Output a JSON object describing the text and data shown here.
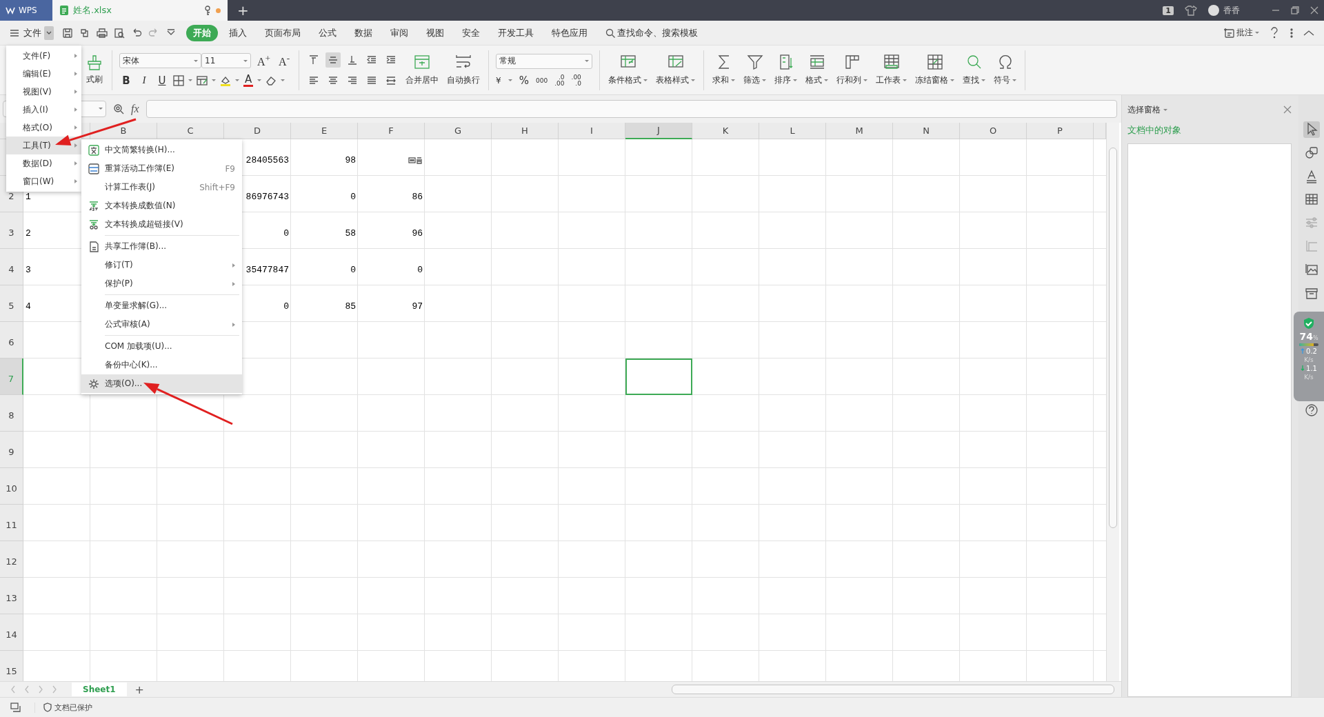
{
  "title_bar": {
    "app_tab": "WPS",
    "document_tab": {
      "title": "姓名.xlsx",
      "selected": true,
      "unsaved": true
    },
    "new_tab": "+",
    "page_count": "1",
    "user_name": "香香"
  },
  "menu_bar": {
    "file_menu": "文件",
    "tabs": [
      {
        "label": "开始",
        "selected": true
      },
      {
        "label": "插入",
        "selected": false
      },
      {
        "label": "页面布局",
        "selected": false
      },
      {
        "label": "公式",
        "selected": false
      },
      {
        "label": "数据",
        "selected": false
      },
      {
        "label": "审阅",
        "selected": false
      },
      {
        "label": "视图",
        "selected": false
      },
      {
        "label": "安全",
        "selected": false
      },
      {
        "label": "开发工具",
        "selected": false
      },
      {
        "label": "特色应用",
        "selected": false
      }
    ],
    "search": {
      "placeholder": "查找命令、搜索模板"
    },
    "comment_button": "批注"
  },
  "ribbon": {
    "format_painter": "式刷",
    "font_name": "宋体",
    "font_size": "11",
    "font_size_buttons": [
      "A$^{+}$",
      "A$^{-}$"
    ],
    "style_buttons": [
      "B",
      "I",
      "U"
    ],
    "font_color": "A",
    "align_buttons": [
      {
        "selected": false
      },
      {
        "selected": true
      },
      {
        "selected": false
      },
      {
        "selected": false
      },
      {
        "selected": false
      },
      {
        "selected": false
      },
      {
        "selected": false
      },
      {
        "selected": false
      },
      {
        "selected": false
      },
      {
        "selected": false
      }
    ],
    "merge_button": "合并居中",
    "wrap_button": "自动换行",
    "number_format": "常规",
    "number_buttons": [
      {
        "kind": "currency",
        "label": "¥"
      },
      {
        "kind": "percent",
        "label": "%"
      },
      {
        "kind": "thousands",
        "label": "000"
      },
      {
        "kind": "increase_decimal",
        "top": ".0",
        "bottom": ".00"
      },
      {
        "kind": "decrease_decimal",
        "top": ".00",
        "bottom": ".0"
      }
    ],
    "tools": [
      "条件格式",
      "表格样式",
      "求和",
      "筛选",
      "排序",
      "格式",
      "行和列",
      "工作表",
      "冻结窗格",
      "查找",
      "符号"
    ]
  },
  "formula_bar": {
    "fx": "fx"
  },
  "sheet": {
    "columns": [
      {
        "selected": false
      },
      {
        "label": "B",
        "selected": false
      },
      {
        "label": "C",
        "selected": false
      },
      {
        "label": "D",
        "selected": false
      },
      {
        "label": "E",
        "selected": false
      },
      {
        "label": "F",
        "selected": false
      },
      {
        "label": "G",
        "selected": false
      },
      {
        "label": "H",
        "selected": false
      },
      {
        "label": "I",
        "selected": false
      },
      {
        "label": "J",
        "selected": true
      },
      {
        "label": "K",
        "selected": false
      },
      {
        "label": "L",
        "selected": false
      },
      {
        "label": "M",
        "selected": false
      },
      {
        "label": "N",
        "selected": false
      },
      {
        "label": "O",
        "selected": false
      },
      {
        "label": "P",
        "selected": false
      }
    ],
    "rows": [
      {
        "selected": false,
        "cells": [
          null,
          null,
          null,
          "28405563",
          "98",
          {
            "kind": "glyph"
          }
        ]
      },
      {
        "header": "2",
        "selected": false,
        "cells": [
          "1",
          null,
          null,
          "86976743",
          "0",
          "86"
        ]
      },
      {
        "header": "3",
        "selected": false,
        "cells": [
          "2",
          null,
          null,
          "0",
          "58",
          "96"
        ]
      },
      {
        "header": "4",
        "selected": false,
        "cells": [
          "3",
          null,
          null,
          "35477847",
          "0",
          "0"
        ]
      },
      {
        "header": "5",
        "selected": false,
        "cells": [
          "4",
          null,
          null,
          "0",
          "85",
          "97"
        ]
      },
      {
        "header": "6",
        "selected": false,
        "cells": []
      },
      {
        "header": "7",
        "selected": true,
        "cells": []
      },
      {
        "header": "8",
        "selected": false,
        "cells": []
      },
      {
        "header": "9",
        "selected": false,
        "cells": []
      },
      {
        "header": "10",
        "selected": false,
        "cells": []
      },
      {
        "header": "11",
        "selected": false,
        "cells": []
      },
      {
        "header": "12",
        "selected": false,
        "cells": []
      },
      {
        "header": "13",
        "selected": false,
        "cells": []
      },
      {
        "header": "14",
        "selected": false,
        "cells": []
      },
      {
        "header": "15",
        "selected": false,
        "cells": []
      }
    ]
  },
  "sheet_tabs": [
    {
      "label": "Sheet1",
      "selected": true
    }
  ],
  "add_sheet": "+",
  "status_bar": {
    "protection": "文档已保护"
  },
  "selection_pane": {
    "title": "选择窗格",
    "heading": "文档中的对象"
  },
  "side_tools": [
    {
      "selected": true,
      "disabled": false
    },
    {
      "selected": false,
      "disabled": false
    },
    {
      "selected": false,
      "disabled": false
    },
    {
      "selected": false,
      "disabled": false
    },
    {
      "selected": false,
      "disabled": true
    },
    {
      "selected": false,
      "disabled": true
    },
    {
      "selected": false,
      "disabled": false
    },
    {
      "selected": false,
      "disabled": false
    },
    {
      "selected": false,
      "disabled": false
    }
  ],
  "speed_widget": {
    "percent": "74",
    "percent_sign": "%",
    "level": 0.74,
    "upload": "0.2",
    "upload_unit": "K/s",
    "download": "1.1",
    "download_unit": "K/s"
  },
  "main_menu": [
    {
      "label": "文件(F)",
      "selected": false
    },
    {
      "label": "编辑(E)",
      "selected": false
    },
    {
      "label": "视图(V)",
      "selected": false
    },
    {
      "label": "插入(I)",
      "selected": false
    },
    {
      "label": "格式(O)",
      "selected": false
    },
    {
      "label": "工具(T)",
      "selected": true
    },
    {
      "label": "数据(D)",
      "selected": false
    },
    {
      "label": "窗口(W)",
      "selected": false
    }
  ],
  "tools_menu": [
    {
      "kind": "item",
      "label": "中文简繁转换(H)...",
      "selected": false
    },
    {
      "kind": "item",
      "label": "重算活动工作簿(E)",
      "shortcut": "F9",
      "selected": false
    },
    {
      "kind": "item",
      "label": "计算工作表(J)",
      "shortcut": "Shift+F9",
      "selected": false
    },
    {
      "kind": "item",
      "label": "文本转换成数值(N)",
      "selected": false
    },
    {
      "kind": "item",
      "label": "文本转换成超链接(V)",
      "selected": false
    },
    {
      "kind": "separator"
    },
    {
      "kind": "item",
      "label": "共享工作簿(B)...",
      "selected": false
    },
    {
      "kind": "submenu",
      "label": "修订(T)",
      "selected": false
    },
    {
      "kind": "submenu",
      "label": "保护(P)",
      "selected": false
    },
    {
      "kind": "separator"
    },
    {
      "kind": "item",
      "label": "单变量求解(G)...",
      "selected": false
    },
    {
      "kind": "submenu",
      "label": "公式审核(A)",
      "selected": false
    },
    {
      "kind": "separator"
    },
    {
      "kind": "item",
      "label": "COM 加载项(U)...",
      "selected": false
    },
    {
      "kind": "item",
      "label": "备份中心(K)...",
      "selected": false
    },
    {
      "kind": "item",
      "label": "选项(O)...",
      "selected": true
    }
  ]
}
